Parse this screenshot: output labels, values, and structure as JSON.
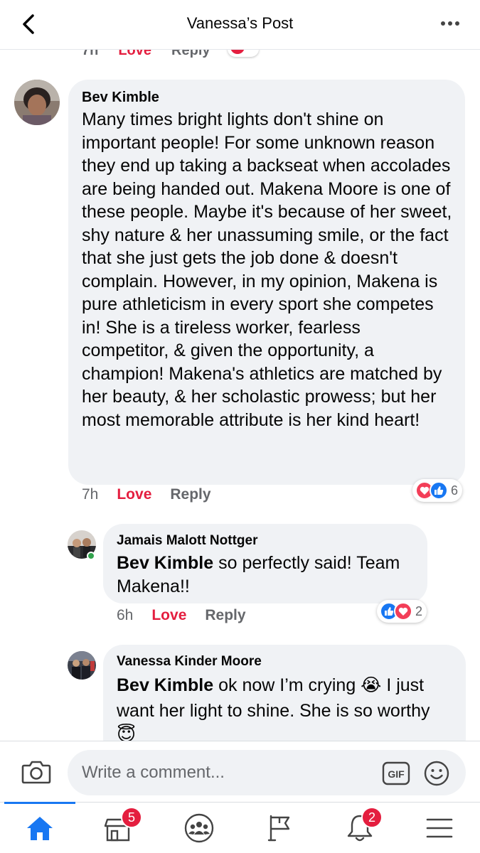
{
  "header": {
    "title": "Vanessa’s Post"
  },
  "prev_comment": {
    "time": "7h",
    "love": "Love",
    "reply": "Reply"
  },
  "comments": [
    {
      "author": "Bev Kimble",
      "text": "Many times bright lights don't shine on important people!  For some unknown reason they end up  taking a backseat when accolades are being handed out.  Makena Moore is one  of these people.  Maybe it's because of her sweet, shy nature & her unassuming smile, or the fact that she just gets the job done & doesn't complain.  However, in my opinion,  Makena is pure athleticism in every sport she competes in!  She is a tireless worker,  fearless competitor,  & given the opportunity,  a champion!  Makena's athletics are matched by her beauty,  & her scholastic prowess; but her most memorable attribute is her kind heart!",
      "time": "7h",
      "love_label": "Love",
      "reply_label": "Reply",
      "reaction_count": "6"
    },
    {
      "author": "Jamais Malott Nottger",
      "mention": "Bev Kimble",
      "text": " so perfectly said! Team Makena!!",
      "time": "6h",
      "love_label": "Love",
      "reply_label": "Reply",
      "reaction_count": "2"
    },
    {
      "author": "Vanessa Kinder Moore",
      "mention": "Bev Kimble",
      "text": " ok now I’m crying 😭 I just want her light to shine. She is so worthy",
      "emoji_trailing": "😇"
    }
  ],
  "composer": {
    "placeholder": "Write a comment...",
    "gif_label": "GIF"
  },
  "tabbar": {
    "marketplace_badge": "5",
    "notifications_badge": "2",
    "tabs": [
      "home-icon",
      "marketplace-icon",
      "groups-icon",
      "pages-icon",
      "notifications-icon",
      "menu-icon"
    ]
  },
  "colors": {
    "accent": "#1877f2",
    "love": "#e41e3f",
    "bubble": "#f0f2f5"
  }
}
